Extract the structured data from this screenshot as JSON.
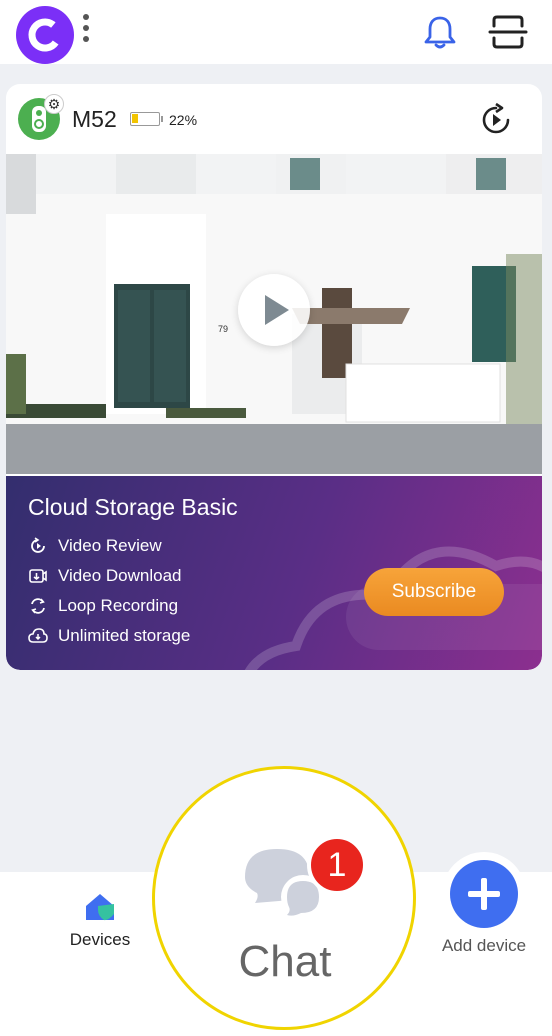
{
  "header": {
    "logo_icon": "app-logo-c",
    "menu_icon": "kebab-vertical-icon",
    "notification_icon": "bell-icon",
    "scan_icon": "scan-icon"
  },
  "device": {
    "name": "M52",
    "battery_percent_label": "22%",
    "battery_level": 0.22,
    "battery_color": "#f2c400",
    "playback_icon": "playback-icon",
    "play_icon": "play-icon"
  },
  "promo": {
    "title": "Cloud Storage Basic",
    "features": [
      {
        "label": "Video Review",
        "icon": "rewind-icon"
      },
      {
        "label": "Video Download",
        "icon": "download-icon"
      },
      {
        "label": "Loop Recording",
        "icon": "loop-icon"
      },
      {
        "label": "Unlimited storage",
        "icon": "cloud-icon"
      }
    ],
    "subscribe_label": "Subscribe",
    "accent": "#f39c2f"
  },
  "nav": {
    "devices_label": "Devices",
    "chat_label": "Chat",
    "chat_badge": "1",
    "add_device_label": "Add device",
    "add_color": "#3f6ef0"
  }
}
